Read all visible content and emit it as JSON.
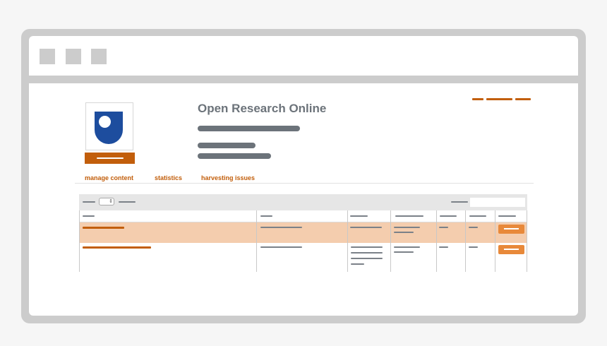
{
  "window": {
    "controls": [
      "window-control",
      "window-control",
      "window-control"
    ]
  },
  "repository": {
    "title": "Open Research Online",
    "logo_icon": "open-university-shield-icon"
  },
  "nav": {
    "items": [
      {
        "label": "manage content"
      },
      {
        "label": "statistics"
      },
      {
        "label": "harvesting issues"
      }
    ]
  },
  "table": {
    "page_size_selector_icon": "updown-arrows-icon",
    "selected_row": 1,
    "row_count": 2
  },
  "colors": {
    "accent": "#c25e0b",
    "action_button": "#e8893a",
    "highlight_row": "#f4cdae",
    "logo_blue": "#1d4d9e",
    "text_gray": "#6c737a"
  }
}
